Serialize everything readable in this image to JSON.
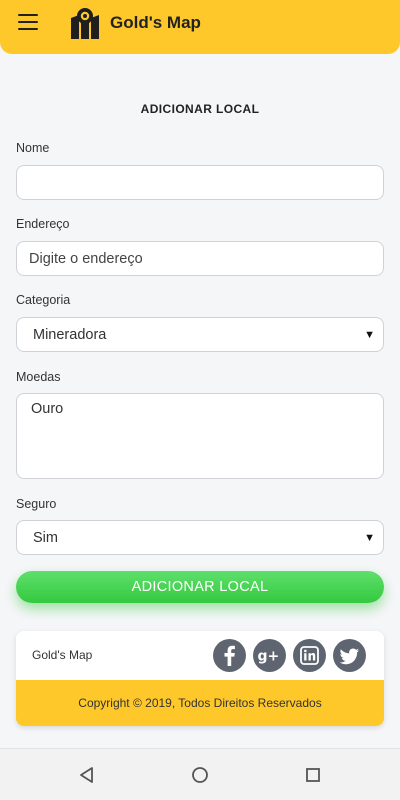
{
  "app": {
    "title": "Gold's Map"
  },
  "page": {
    "title": "ADICIONAR LOCAL"
  },
  "form": {
    "nome": {
      "label": "Nome",
      "value": ""
    },
    "endereco": {
      "label": "Endereço",
      "placeholder": "Digite o endereço",
      "value": ""
    },
    "categoria": {
      "label": "Categoria",
      "selected": "Mineradora"
    },
    "moedas": {
      "label": "Moedas",
      "value": "Ouro"
    },
    "seguro": {
      "label": "Seguro",
      "selected": "Sim"
    },
    "submit_label": "ADICIONAR LOCAL"
  },
  "footer": {
    "brand": "Gold's Map",
    "copyright": "Copyright © 2019, Todos Direitos Reservados",
    "social": [
      "facebook-icon",
      "google-plus-icon",
      "linkedin-icon",
      "twitter-icon"
    ]
  },
  "colors": {
    "brand": "#fec82a",
    "button": "#3fcc4a",
    "social": "#5f6570"
  }
}
